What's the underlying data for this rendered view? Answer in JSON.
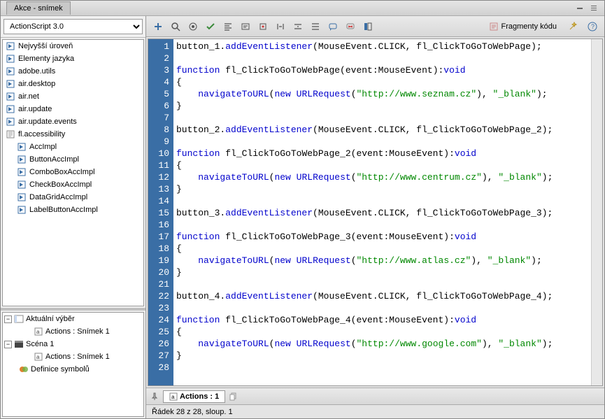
{
  "window": {
    "title": "Akce - snímek"
  },
  "sidebar": {
    "dropdown": "ActionScript 3.0",
    "packages": [
      "Nejvyšší úroveň",
      "Elementy jazyka",
      "adobe.utils",
      "air.desktop",
      "air.net",
      "air.update",
      "air.update.events",
      "fl.accessibility"
    ],
    "classes": [
      "AccImpl",
      "ButtonAccImpl",
      "ComboBoxAccImpl",
      "CheckBoxAccImpl",
      "DataGridAccImpl",
      "LabelButtonAccImpl"
    ],
    "nav": {
      "current_selection": "Aktuální výběr",
      "actions_frame": "Actions : Snímek 1",
      "scene": "Scéna 1",
      "actions_frame2": "Actions : Snímek 1",
      "symbol_defs": "Definice symbolů"
    }
  },
  "toolbar": {
    "fragments": "Fragmenty kódu"
  },
  "code_lines": [
    {
      "n": 1,
      "t": "button_1.addEventListener(MouseEvent.CLICK, fl_ClickToGoToWebPage);",
      "cls": "stmt"
    },
    {
      "n": 2,
      "t": ""
    },
    {
      "n": 3,
      "t": "function fl_ClickToGoToWebPage(event:MouseEvent):void",
      "cls": "func"
    },
    {
      "n": 4,
      "t": "{"
    },
    {
      "n": 5,
      "t": "    navigateToURL(new URLRequest(\"http://www.seznam.cz\"), \"_blank\");",
      "cls": "nav",
      "url": "http://www.seznam.cz"
    },
    {
      "n": 6,
      "t": "}"
    },
    {
      "n": 7,
      "t": ""
    },
    {
      "n": 8,
      "t": "button_2.addEventListener(MouseEvent.CLICK, fl_ClickToGoToWebPage_2);",
      "cls": "stmt"
    },
    {
      "n": 9,
      "t": ""
    },
    {
      "n": 10,
      "t": "function fl_ClickToGoToWebPage_2(event:MouseEvent):void",
      "cls": "func"
    },
    {
      "n": 11,
      "t": "{"
    },
    {
      "n": 12,
      "t": "    navigateToURL(new URLRequest(\"http://www.centrum.cz\"), \"_blank\");",
      "cls": "nav",
      "url": "http://www.centrum.cz"
    },
    {
      "n": 13,
      "t": "}"
    },
    {
      "n": 14,
      "t": ""
    },
    {
      "n": 15,
      "t": "button_3.addEventListener(MouseEvent.CLICK, fl_ClickToGoToWebPage_3);",
      "cls": "stmt"
    },
    {
      "n": 16,
      "t": ""
    },
    {
      "n": 17,
      "t": "function fl_ClickToGoToWebPage_3(event:MouseEvent):void",
      "cls": "func"
    },
    {
      "n": 18,
      "t": "{"
    },
    {
      "n": 19,
      "t": "    navigateToURL(new URLRequest(\"http://www.atlas.cz\"), \"_blank\");",
      "cls": "nav",
      "url": "http://www.atlas.cz"
    },
    {
      "n": 20,
      "t": "}"
    },
    {
      "n": 21,
      "t": ""
    },
    {
      "n": 22,
      "t": "button_4.addEventListener(MouseEvent.CLICK, fl_ClickToGoToWebPage_4);",
      "cls": "stmt"
    },
    {
      "n": 23,
      "t": ""
    },
    {
      "n": 24,
      "t": "function fl_ClickToGoToWebPage_4(event:MouseEvent):void",
      "cls": "func"
    },
    {
      "n": 25,
      "t": "{"
    },
    {
      "n": 26,
      "t": "    navigateToURL(new URLRequest(\"http://www.google.com\"), \"_blank\");",
      "cls": "nav",
      "url": "http://www.google.com"
    },
    {
      "n": 27,
      "t": "}"
    },
    {
      "n": 28,
      "t": ""
    }
  ],
  "bottom": {
    "tab": "Actions : 1"
  },
  "status": {
    "text": "Řádek 28 z 28, sloup. 1"
  }
}
